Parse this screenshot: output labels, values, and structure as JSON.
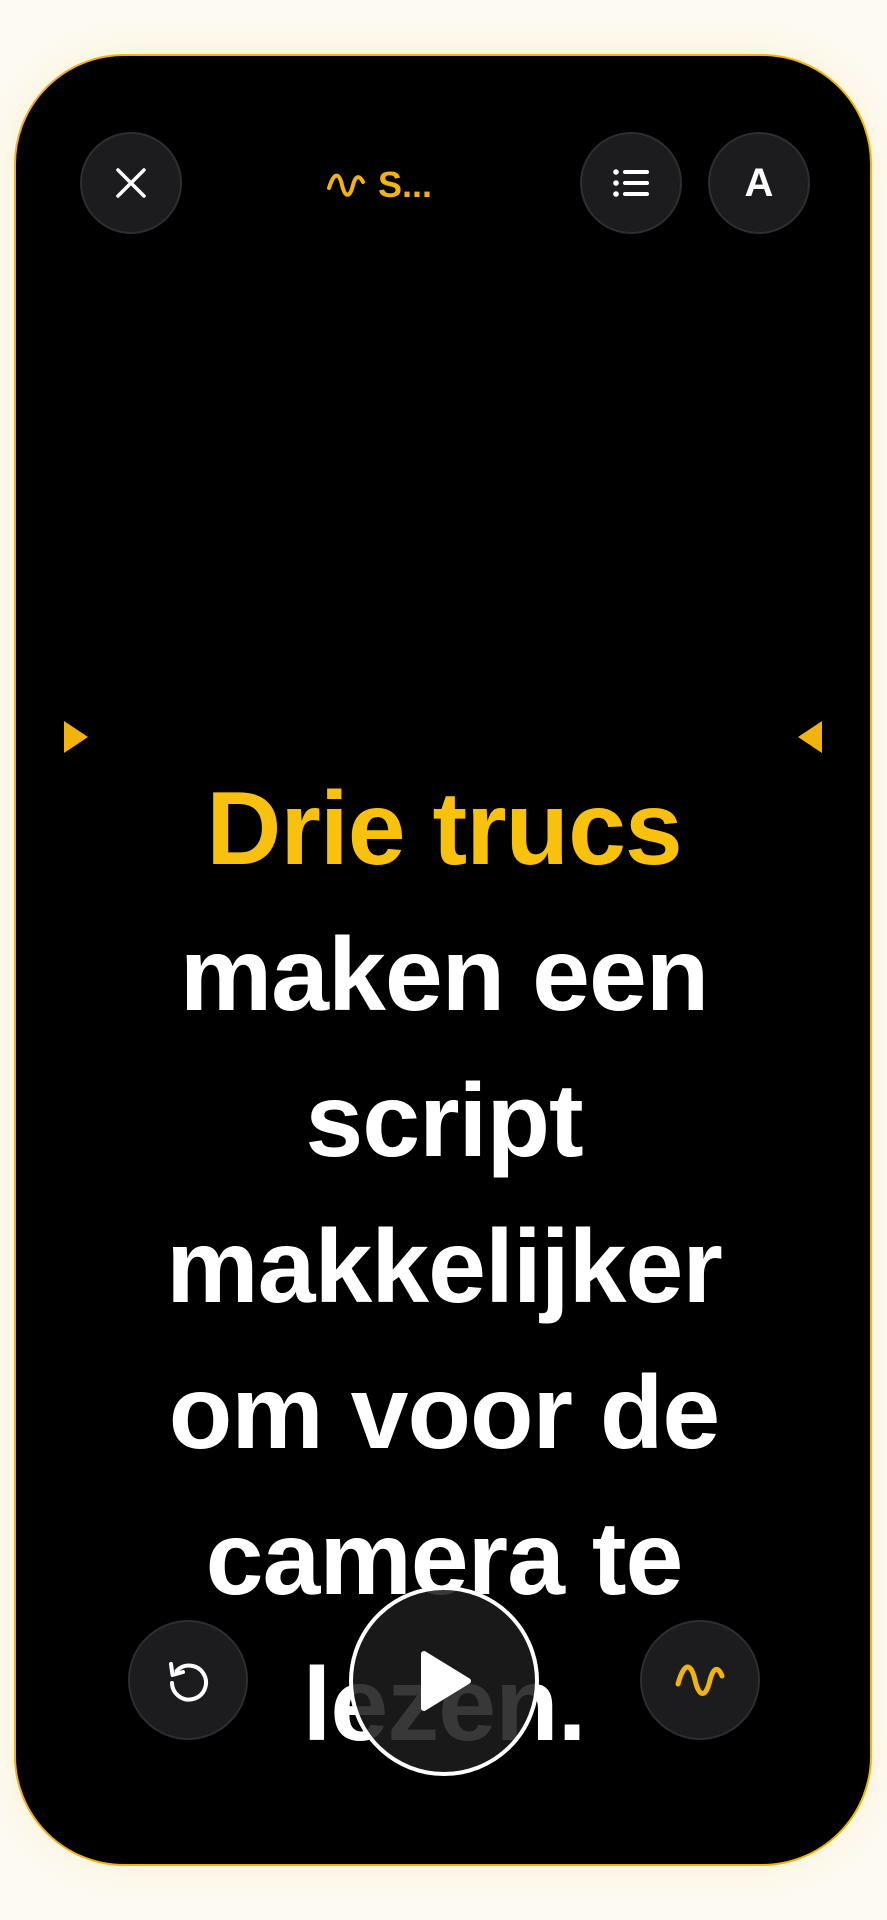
{
  "header": {
    "title": "S...",
    "title_icon": "waveform-icon",
    "close_icon": "close-icon",
    "list_icon": "list-icon",
    "font_label": "A"
  },
  "script": {
    "highlighted": "Drie trucs",
    "lines": [
      "maken een",
      "script",
      "makkelijker",
      "om voor de",
      "camera te",
      "lezen."
    ]
  },
  "controls": {
    "restart_icon": "restart-icon",
    "play_icon": "play-icon",
    "voice_icon": "waveform-icon"
  },
  "colors": {
    "accent": "#f2b40c",
    "highlight_text": "#f8c10d",
    "background": "#000000",
    "button_bg": "#1c1c1e"
  }
}
